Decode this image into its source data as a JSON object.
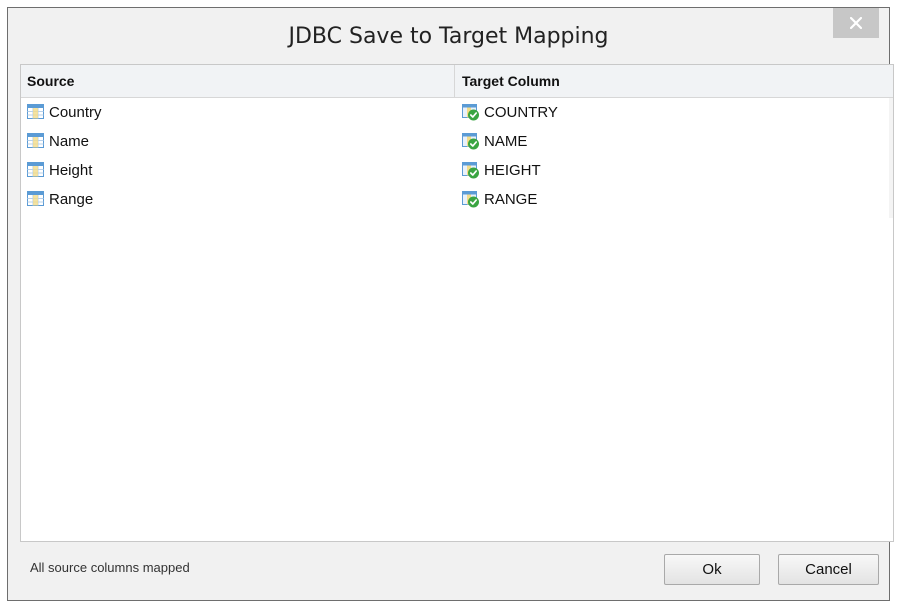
{
  "dialog": {
    "title": "JDBC Save to Target Mapping",
    "close_label": "×"
  },
  "table": {
    "headers": {
      "source": "Source",
      "target": "Target Column"
    },
    "rows": [
      {
        "source": "Country",
        "target": "COUNTRY"
      },
      {
        "source": "Name",
        "target": "NAME"
      },
      {
        "source": "Height",
        "target": "HEIGHT"
      },
      {
        "source": "Range",
        "target": "RANGE"
      }
    ]
  },
  "footer": {
    "status": "All source columns mapped",
    "ok_label": "Ok",
    "cancel_label": "Cancel"
  },
  "icons": {
    "source_row": "table-column-icon",
    "target_row": "mapped-column-check-icon",
    "close": "close-icon"
  },
  "colors": {
    "icon_blue": "#5b9bd5",
    "icon_check_green": "#3aa542",
    "icon_target_body": "#8fbf60"
  }
}
